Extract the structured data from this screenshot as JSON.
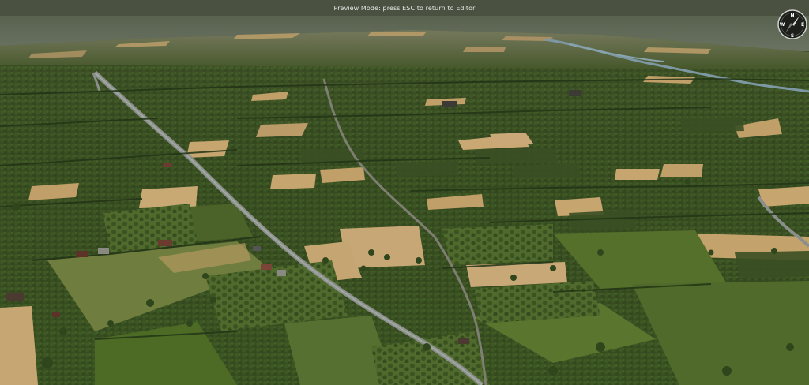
{
  "status_bar": {
    "message": "Preview Mode: press ESC to return to Editor"
  },
  "compass": {
    "north": "N",
    "east": "E",
    "south": "S",
    "west": "W",
    "icon": "compass-icon"
  },
  "colors": {
    "sky": "#5a6350",
    "horizon_haze": "#6c7460",
    "forest": "#364d22",
    "grass": "#566b2c",
    "grass_light": "#6b7d3a",
    "wheat": "#c2a06a",
    "road": "#8b8f8a",
    "river": "#7c98a4"
  }
}
